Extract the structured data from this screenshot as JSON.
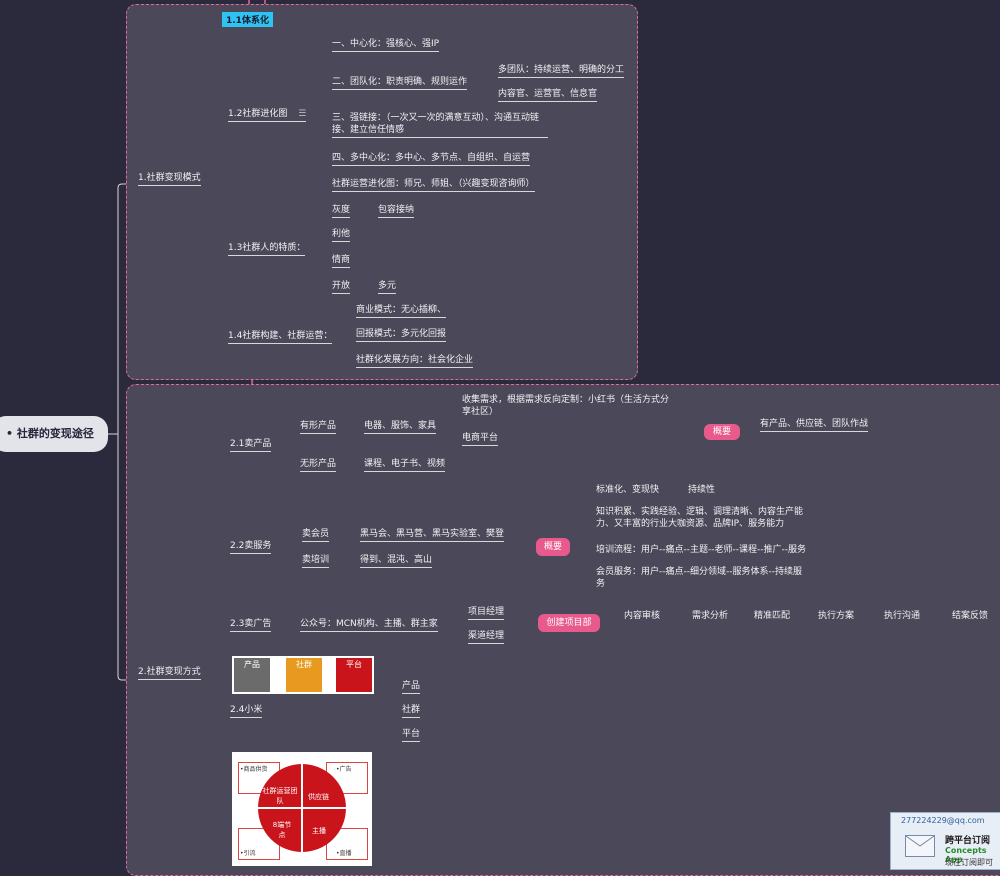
{
  "root": {
    "label": "社群的变现途径",
    "marker": "•"
  },
  "section1": {
    "title": "1.社群变现模式",
    "n11": "1.1体系化",
    "n12": "1.2社群进化图",
    "n12_icon": "notes-icon",
    "n12_items": [
      "一、中心化：强核心、强IP",
      "二、团队化：职责明确、规则运作",
      "三、强链接：（一次又一次的满意互动）、沟通互动链接、建立信任情感",
      "四、多中心化：多中心、多节点、自组织、自运营",
      "社群运营进化图：师兄、师姐、（兴趣变现咨询师）"
    ],
    "n12_team_children": [
      "多团队：持续运营、明确的分工",
      "内容官、运营官、信息官"
    ],
    "n13": "1.3社群人的特质：",
    "n13_items": [
      "灰度",
      "包容接纳",
      "利他",
      "情商",
      "开放",
      "多元"
    ],
    "n14": "1.4社群构建、社群运营：",
    "n14_items": [
      "商业模式：无心插柳、",
      "回报模式：多元化回报",
      "社群化发展方向：社会化企业"
    ]
  },
  "section2": {
    "title": "2.社群变现方式",
    "n21": "2.1卖产品",
    "n21_a": "有形产品",
    "n21_a_val": "电器、服饰、家具",
    "n21_a_c1": "收集需求，根据需求反向定制：小红书（生活方式分享社区）",
    "n21_a_c2": "电商平台",
    "n21_b": "无形产品",
    "n21_b_val": "课程、电子书、视频",
    "n21_summary": "概要",
    "n21_summary_val": "有产品、供应链、团队作战",
    "n22": "2.2卖服务",
    "n22_a": "卖会员",
    "n22_a_val": "黑马会、黑马营、黑马实验室、樊登",
    "n22_b": "卖培训",
    "n22_b_val": "得到、混沌、高山",
    "n22_summary": "概要",
    "n22_s_items": [
      "标准化、变现快",
      "持续性",
      "知识积累、实践经验、逻辑、调理清晰、内容生产能力、又丰富的行业大咖资源、品牌IP、服务能力",
      "培训流程：用户--痛点--主题--老师--课程--推广--服务",
      "会员服务：用户--痛点--细分领域--服务体系--持续服务"
    ],
    "n23": "2.3卖广告",
    "n23_val": "公众号：MCN机构、主播、群主家",
    "n23_c": [
      "项目经理",
      "渠道经理"
    ],
    "n23_pill": "创建项目部",
    "n23_steps": [
      "内容审核",
      "需求分析",
      "精准匹配",
      "执行方案",
      "执行沟通",
      "结案反馈"
    ],
    "img1": {
      "labels": [
        "产品",
        "社群",
        "平台"
      ]
    },
    "n24": "2.4小米",
    "n24_items": [
      "产品",
      "社群",
      "平台"
    ],
    "img2": {
      "center": "社群运营团队",
      "right": "供应链",
      "bl": "8端节点",
      "br": "主播",
      "corners": [
        "•商品供货",
        "•广告",
        "•引流",
        "•直播"
      ]
    }
  },
  "notification": {
    "email": "277224229@qq.com",
    "title": "跨平台订阅",
    "sub": "Concepts App",
    "line": "现在订阅即可"
  },
  "colors": {
    "bg": "#2b2a3c",
    "frame": "#4a4859",
    "accent": "#e85a8c",
    "selected": "#2ec3f2"
  }
}
